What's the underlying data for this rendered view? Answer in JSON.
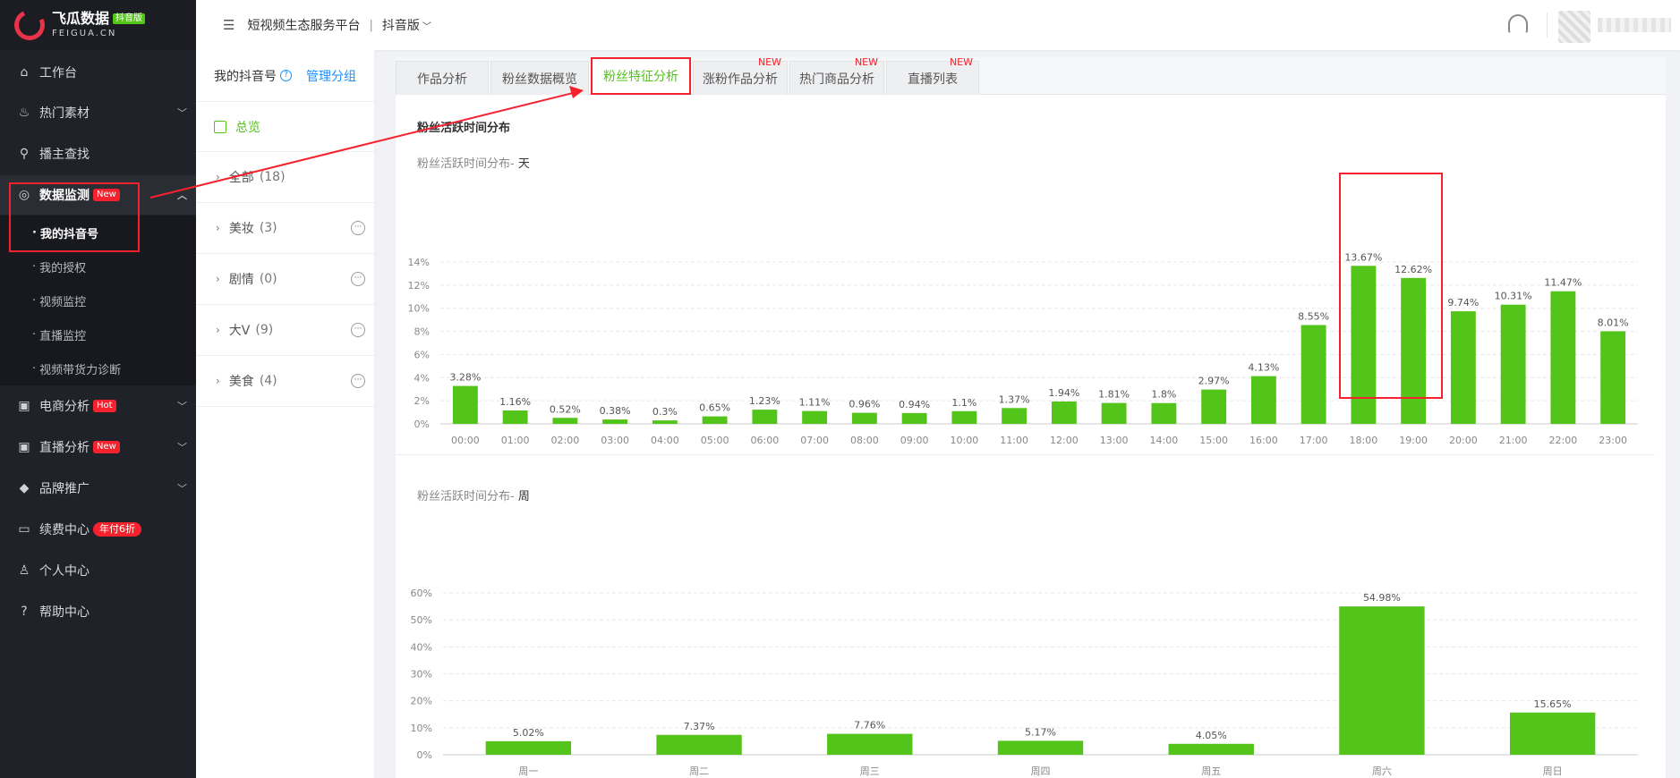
{
  "logo": {
    "name": "飞瓜数据",
    "tag": "抖音版",
    "en": "FEIGUA.CN"
  },
  "sidebar": {
    "items": [
      {
        "label": "工作台",
        "icon": "home-icon",
        "glyph": "⌂"
      },
      {
        "label": "热门素材",
        "icon": "fire-icon",
        "glyph": "♨"
      },
      {
        "label": "播主查找",
        "icon": "search-icon",
        "glyph": "⚲"
      },
      {
        "label": "数据监测",
        "icon": "monitor-icon",
        "glyph": "◎",
        "badge": "New"
      },
      {
        "label": "电商分析",
        "icon": "shop-icon",
        "glyph": "▣",
        "badge": "Hot"
      },
      {
        "label": "直播分析",
        "icon": "live-icon",
        "glyph": "▣",
        "badge": "New"
      },
      {
        "label": "品牌推广",
        "icon": "diamond-icon",
        "glyph": "◆"
      },
      {
        "label": "续费中心",
        "icon": "card-icon",
        "glyph": "▭",
        "badge": "年付6折"
      },
      {
        "label": "个人中心",
        "icon": "user-icon",
        "glyph": "♙"
      },
      {
        "label": "帮助中心",
        "icon": "help-icon",
        "glyph": "?"
      }
    ],
    "sub_items": [
      {
        "label": "我的抖音号"
      },
      {
        "label": "我的授权"
      },
      {
        "label": "视频监控"
      },
      {
        "label": "直播监控"
      },
      {
        "label": "视频带货力诊断"
      }
    ]
  },
  "header": {
    "platform": "短视频生态服务平台",
    "separator": "|",
    "version": "抖音版"
  },
  "panel": {
    "title": "我的抖音号",
    "manage": "管理分组",
    "overview": "总览",
    "groups": [
      {
        "name": "全部",
        "count": "(18)"
      },
      {
        "name": "美妆",
        "count": "(3)"
      },
      {
        "name": "剧情",
        "count": "(0)"
      },
      {
        "name": "大V",
        "count": "(9)"
      },
      {
        "name": "美食",
        "count": "(4)"
      }
    ]
  },
  "tabs": [
    {
      "label": "作品分析"
    },
    {
      "label": "粉丝数据概览"
    },
    {
      "label": "粉丝特征分析"
    },
    {
      "label": "涨粉作品分析",
      "new": "NEW"
    },
    {
      "label": "热门商品分析",
      "new": "NEW"
    },
    {
      "label": "直播列表",
      "new": "NEW"
    }
  ],
  "section": {
    "title": "粉丝活跃时间分布"
  },
  "colors": {
    "bar": "#52c41a",
    "accent": "#52c41a",
    "highlight": "#f5222d",
    "link": "#1890ff"
  },
  "chart_data": [
    {
      "type": "bar",
      "title_prefix": "粉丝活跃时间分布-",
      "title_unit": "天",
      "categories": [
        "00:00",
        "01:00",
        "02:00",
        "03:00",
        "04:00",
        "05:00",
        "06:00",
        "07:00",
        "08:00",
        "09:00",
        "10:00",
        "11:00",
        "12:00",
        "13:00",
        "14:00",
        "15:00",
        "16:00",
        "17:00",
        "18:00",
        "19:00",
        "20:00",
        "21:00",
        "22:00",
        "23:00"
      ],
      "values": [
        3.28,
        1.16,
        0.52,
        0.38,
        0.3,
        0.65,
        1.23,
        1.11,
        0.96,
        0.94,
        1.1,
        1.37,
        1.94,
        1.81,
        1.8,
        2.97,
        4.13,
        8.55,
        13.67,
        12.62,
        9.74,
        10.31,
        11.47,
        8.01
      ],
      "labels": [
        "3.28%",
        "1.16%",
        "0.52%",
        "0.38%",
        "0.3%",
        "0.65%",
        "1.23%",
        "1.11%",
        "0.96%",
        "0.94%",
        "1.1%",
        "1.37%",
        "1.94%",
        "1.81%",
        "1.8%",
        "2.97%",
        "4.13%",
        "8.55%",
        "13.67%",
        "12.62%",
        "9.74%",
        "10.31%",
        "11.47%",
        "8.01%"
      ],
      "yticks": [
        "0%",
        "2%",
        "4%",
        "6%",
        "8%",
        "10%",
        "12%",
        "14%"
      ],
      "ylim": [
        0,
        14
      ],
      "grid": true
    },
    {
      "type": "bar",
      "title_prefix": "粉丝活跃时间分布-",
      "title_unit": "周",
      "categories": [
        "周一",
        "周二",
        "周三",
        "周四",
        "周五",
        "周六",
        "周日"
      ],
      "values": [
        5.02,
        7.37,
        7.76,
        5.17,
        4.05,
        54.98,
        15.65
      ],
      "labels": [
        "5.02%",
        "7.37%",
        "7.76%",
        "5.17%",
        "4.05%",
        "54.98%",
        "15.65%"
      ],
      "yticks": [
        "0%",
        "10%",
        "20%",
        "30%",
        "40%",
        "50%",
        "60%"
      ],
      "ylim": [
        0,
        60
      ],
      "grid": true
    }
  ]
}
